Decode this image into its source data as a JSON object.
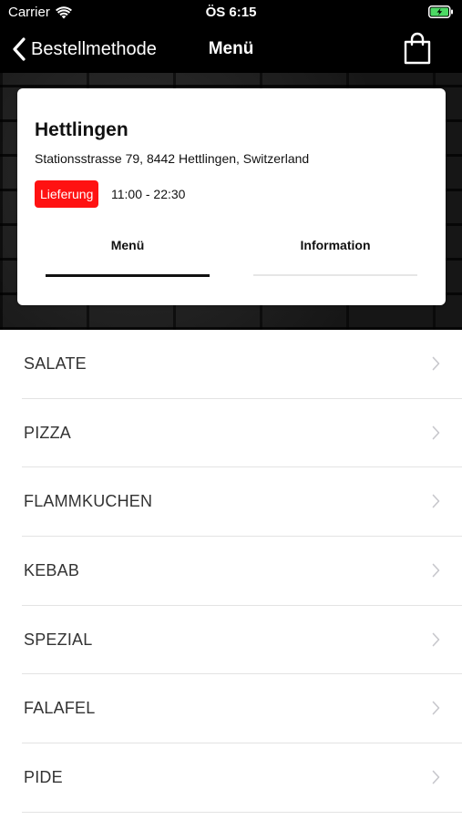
{
  "status_bar": {
    "carrier": "Carrier",
    "time": "ÖS 6:15"
  },
  "nav": {
    "back_label": "Bestellmethode",
    "title": "Menü",
    "cart_icon": "shopping-bag-icon"
  },
  "store": {
    "name": "Hettlingen",
    "address": "Stationsstrasse 79, 8442 Hettlingen, Switzerland",
    "badge": "Lieferung",
    "hours": "11:00 - 22:30"
  },
  "tabs": [
    {
      "label": "Menü",
      "active": true
    },
    {
      "label": "Information",
      "active": false
    }
  ],
  "categories": [
    {
      "label": "SALATE"
    },
    {
      "label": "PIZZA"
    },
    {
      "label": "FLAMMKUCHEN"
    },
    {
      "label": "KEBAB"
    },
    {
      "label": "SPEZIAL"
    },
    {
      "label": "FALAFEL"
    },
    {
      "label": "PIDE"
    }
  ],
  "colors": {
    "bar_background": "#000000",
    "badge": "#ff1212",
    "battery": "#4cd964",
    "chevron": "#c7c7cc"
  }
}
